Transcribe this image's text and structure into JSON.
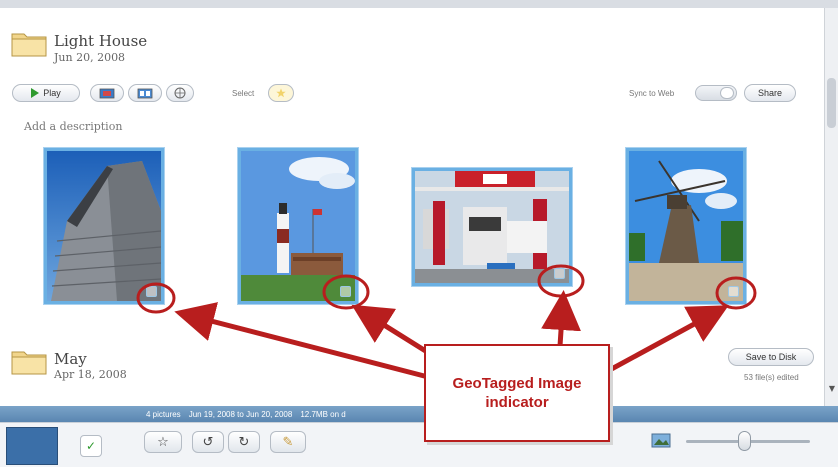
{
  "albums": [
    {
      "title": "Light House",
      "date": "Jun 20, 2008"
    },
    {
      "title": "May",
      "date": "Apr 18, 2008"
    }
  ],
  "toolbar": {
    "play_label": "Play",
    "select_label": "Select",
    "sync_label": "Sync to Web",
    "share_label": "Share"
  },
  "description_placeholder": "Add a description",
  "album2": {
    "save_label": "Save to Disk",
    "edited_text": "53 file(s) edited"
  },
  "status_bar": {
    "pictures": "4 pictures",
    "date_range": "Jun 19, 2008 to Jun 20, 2008",
    "size": "12.7MB on d"
  },
  "callout": {
    "text": "GeoTagged Image indicator"
  },
  "colors": {
    "photo_border": "#6ab0e3",
    "annotation_red": "#b81e1e",
    "status_bar": "#5a86b1"
  },
  "icons": [
    "folder-icon",
    "play-icon",
    "slideshow-icon",
    "collage-icon",
    "geotag-icon",
    "star-icon",
    "rotate-left-icon",
    "rotate-right-icon",
    "edit-icon",
    "zoom-image-icon"
  ]
}
